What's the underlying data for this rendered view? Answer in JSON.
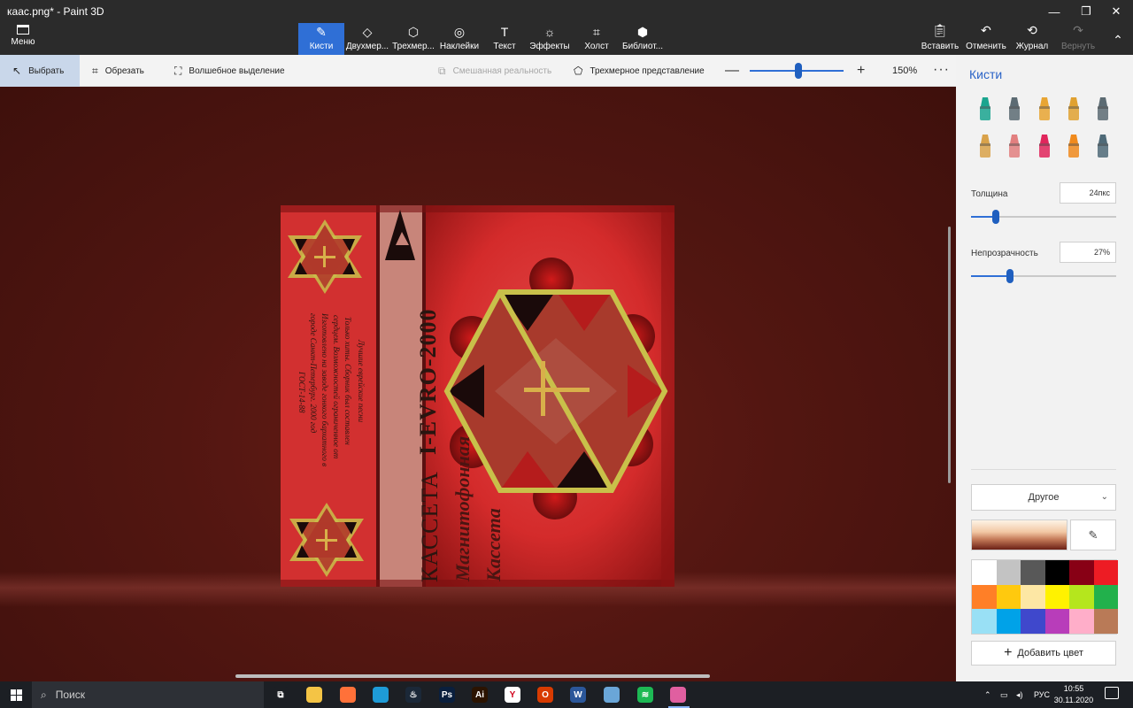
{
  "window": {
    "title": "каас.png* - Paint 3D",
    "minimize": "—",
    "restore": "❐",
    "close": "✕"
  },
  "ribbon": {
    "menu_label": "Меню",
    "tabs": [
      {
        "label": "Кисти",
        "icon": "brush-icon"
      },
      {
        "label": "Двухмер...",
        "icon": "2d-shapes-icon"
      },
      {
        "label": "Трехмер...",
        "icon": "3d-shapes-icon"
      },
      {
        "label": "Наклейки",
        "icon": "stickers-icon"
      },
      {
        "label": "Текст",
        "icon": "text-icon"
      },
      {
        "label": "Эффекты",
        "icon": "effects-icon"
      },
      {
        "label": "Холст",
        "icon": "canvas-icon"
      },
      {
        "label": "Библиот...",
        "icon": "library-icon"
      }
    ],
    "actions": [
      {
        "label": "Вставить",
        "icon": "paste-icon"
      },
      {
        "label": "Отменить",
        "icon": "undo-icon"
      },
      {
        "label": "Журнал",
        "icon": "history-icon"
      },
      {
        "label": "Вернуть",
        "icon": "redo-icon"
      }
    ]
  },
  "toolbar": {
    "select": "Выбрать",
    "crop": "Обрезать",
    "magic_select": "Волшебное выделение",
    "mixed_reality": "Смешанная реальность",
    "view_3d": "Трехмерное представление",
    "zoom_minus": "—",
    "zoom_plus": "+",
    "zoom_value": "150%",
    "zoom_level": 0.52,
    "more": "···"
  },
  "artwork": {
    "spine_title": "КАССЕТА",
    "spine_code": "I-EVRO-2000",
    "front_line1": "Магнитофонная",
    "front_line2": "Кассета",
    "back_text": [
      "Лучшие еврейские песни",
      "Только хиты. Сборник был составлен",
      "сердцем. Возможностей ограниченное от",
      "Изготовлено на заводе гонкого бархатного в",
      "городе Санкт-Петербург. 2000 год",
      "ГОСТ-14-88"
    ]
  },
  "panel": {
    "title": "Кисти",
    "brushes": [
      {
        "name": "marker-brush-icon",
        "color": "#1aa58f"
      },
      {
        "name": "calligraphy-pen-icon",
        "color": "#5c6b73"
      },
      {
        "name": "oil-brush-icon",
        "color": "#e8a533"
      },
      {
        "name": "watercolor-brush-icon",
        "color": "#e0a130"
      },
      {
        "name": "pixel-pen-icon",
        "color": "#5c6b73"
      },
      {
        "name": "pencil-icon",
        "color": "#d9a24a"
      },
      {
        "name": "eraser-icon",
        "color": "#e27f7f"
      },
      {
        "name": "crayon-icon",
        "color": "#e0265c"
      },
      {
        "name": "spray-can-icon",
        "color": "#f08a1d"
      },
      {
        "name": "fill-bucket-icon",
        "color": "#4f6a78"
      }
    ],
    "thickness_label": "Толщина",
    "thickness_value": "24пкс",
    "thickness_level": 0.17,
    "opacity_label": "Непрозрачность",
    "opacity_value": "27%",
    "opacity_level": 0.27,
    "texture_dropdown": "Другое",
    "add_color": "Добавить цвет",
    "palette": [
      "#ffffff",
      "#c3c3c3",
      "#585858",
      "#000000",
      "#880015",
      "#ed1c24",
      "#ff7f27",
      "#ffc90e",
      "#fde7a4",
      "#fff200",
      "#b5e61d",
      "#22b14c",
      "#99e0f5",
      "#00a2e8",
      "#3f48cc",
      "#b83dba",
      "#ffaec9",
      "#b97a57"
    ]
  },
  "taskbar": {
    "search_placeholder": "Поиск",
    "apps": [
      {
        "name": "task-view-icon",
        "color": "#1c1f24",
        "glyph": "⧉"
      },
      {
        "name": "file-explorer-icon",
        "color": "#f4c445",
        "glyph": ""
      },
      {
        "name": "firefox-icon",
        "color": "#ff7139",
        "glyph": ""
      },
      {
        "name": "edge-icon",
        "color": "#1e9bd7",
        "glyph": ""
      },
      {
        "name": "steam-icon",
        "color": "#1b2838",
        "glyph": "♨"
      },
      {
        "name": "photoshop-icon",
        "color": "#0a1f3d",
        "glyph": "Ps"
      },
      {
        "name": "illustrator-icon",
        "color": "#2b1300",
        "glyph": "Ai"
      },
      {
        "name": "yandex-browser-icon",
        "color": "#ffffff",
        "glyph": "Y"
      },
      {
        "name": "office-icon",
        "color": "#d83b01",
        "glyph": "O"
      },
      {
        "name": "word-icon",
        "color": "#2b579a",
        "glyph": "W"
      },
      {
        "name": "paint-icon",
        "color": "#6aa6d8",
        "glyph": ""
      },
      {
        "name": "spotify-icon",
        "color": "#1db954",
        "glyph": "≋"
      },
      {
        "name": "paint3d-icon",
        "color": "#e05fa0",
        "glyph": ""
      }
    ],
    "language": "РУС",
    "time": "10:55",
    "date": "30.11.2020"
  }
}
